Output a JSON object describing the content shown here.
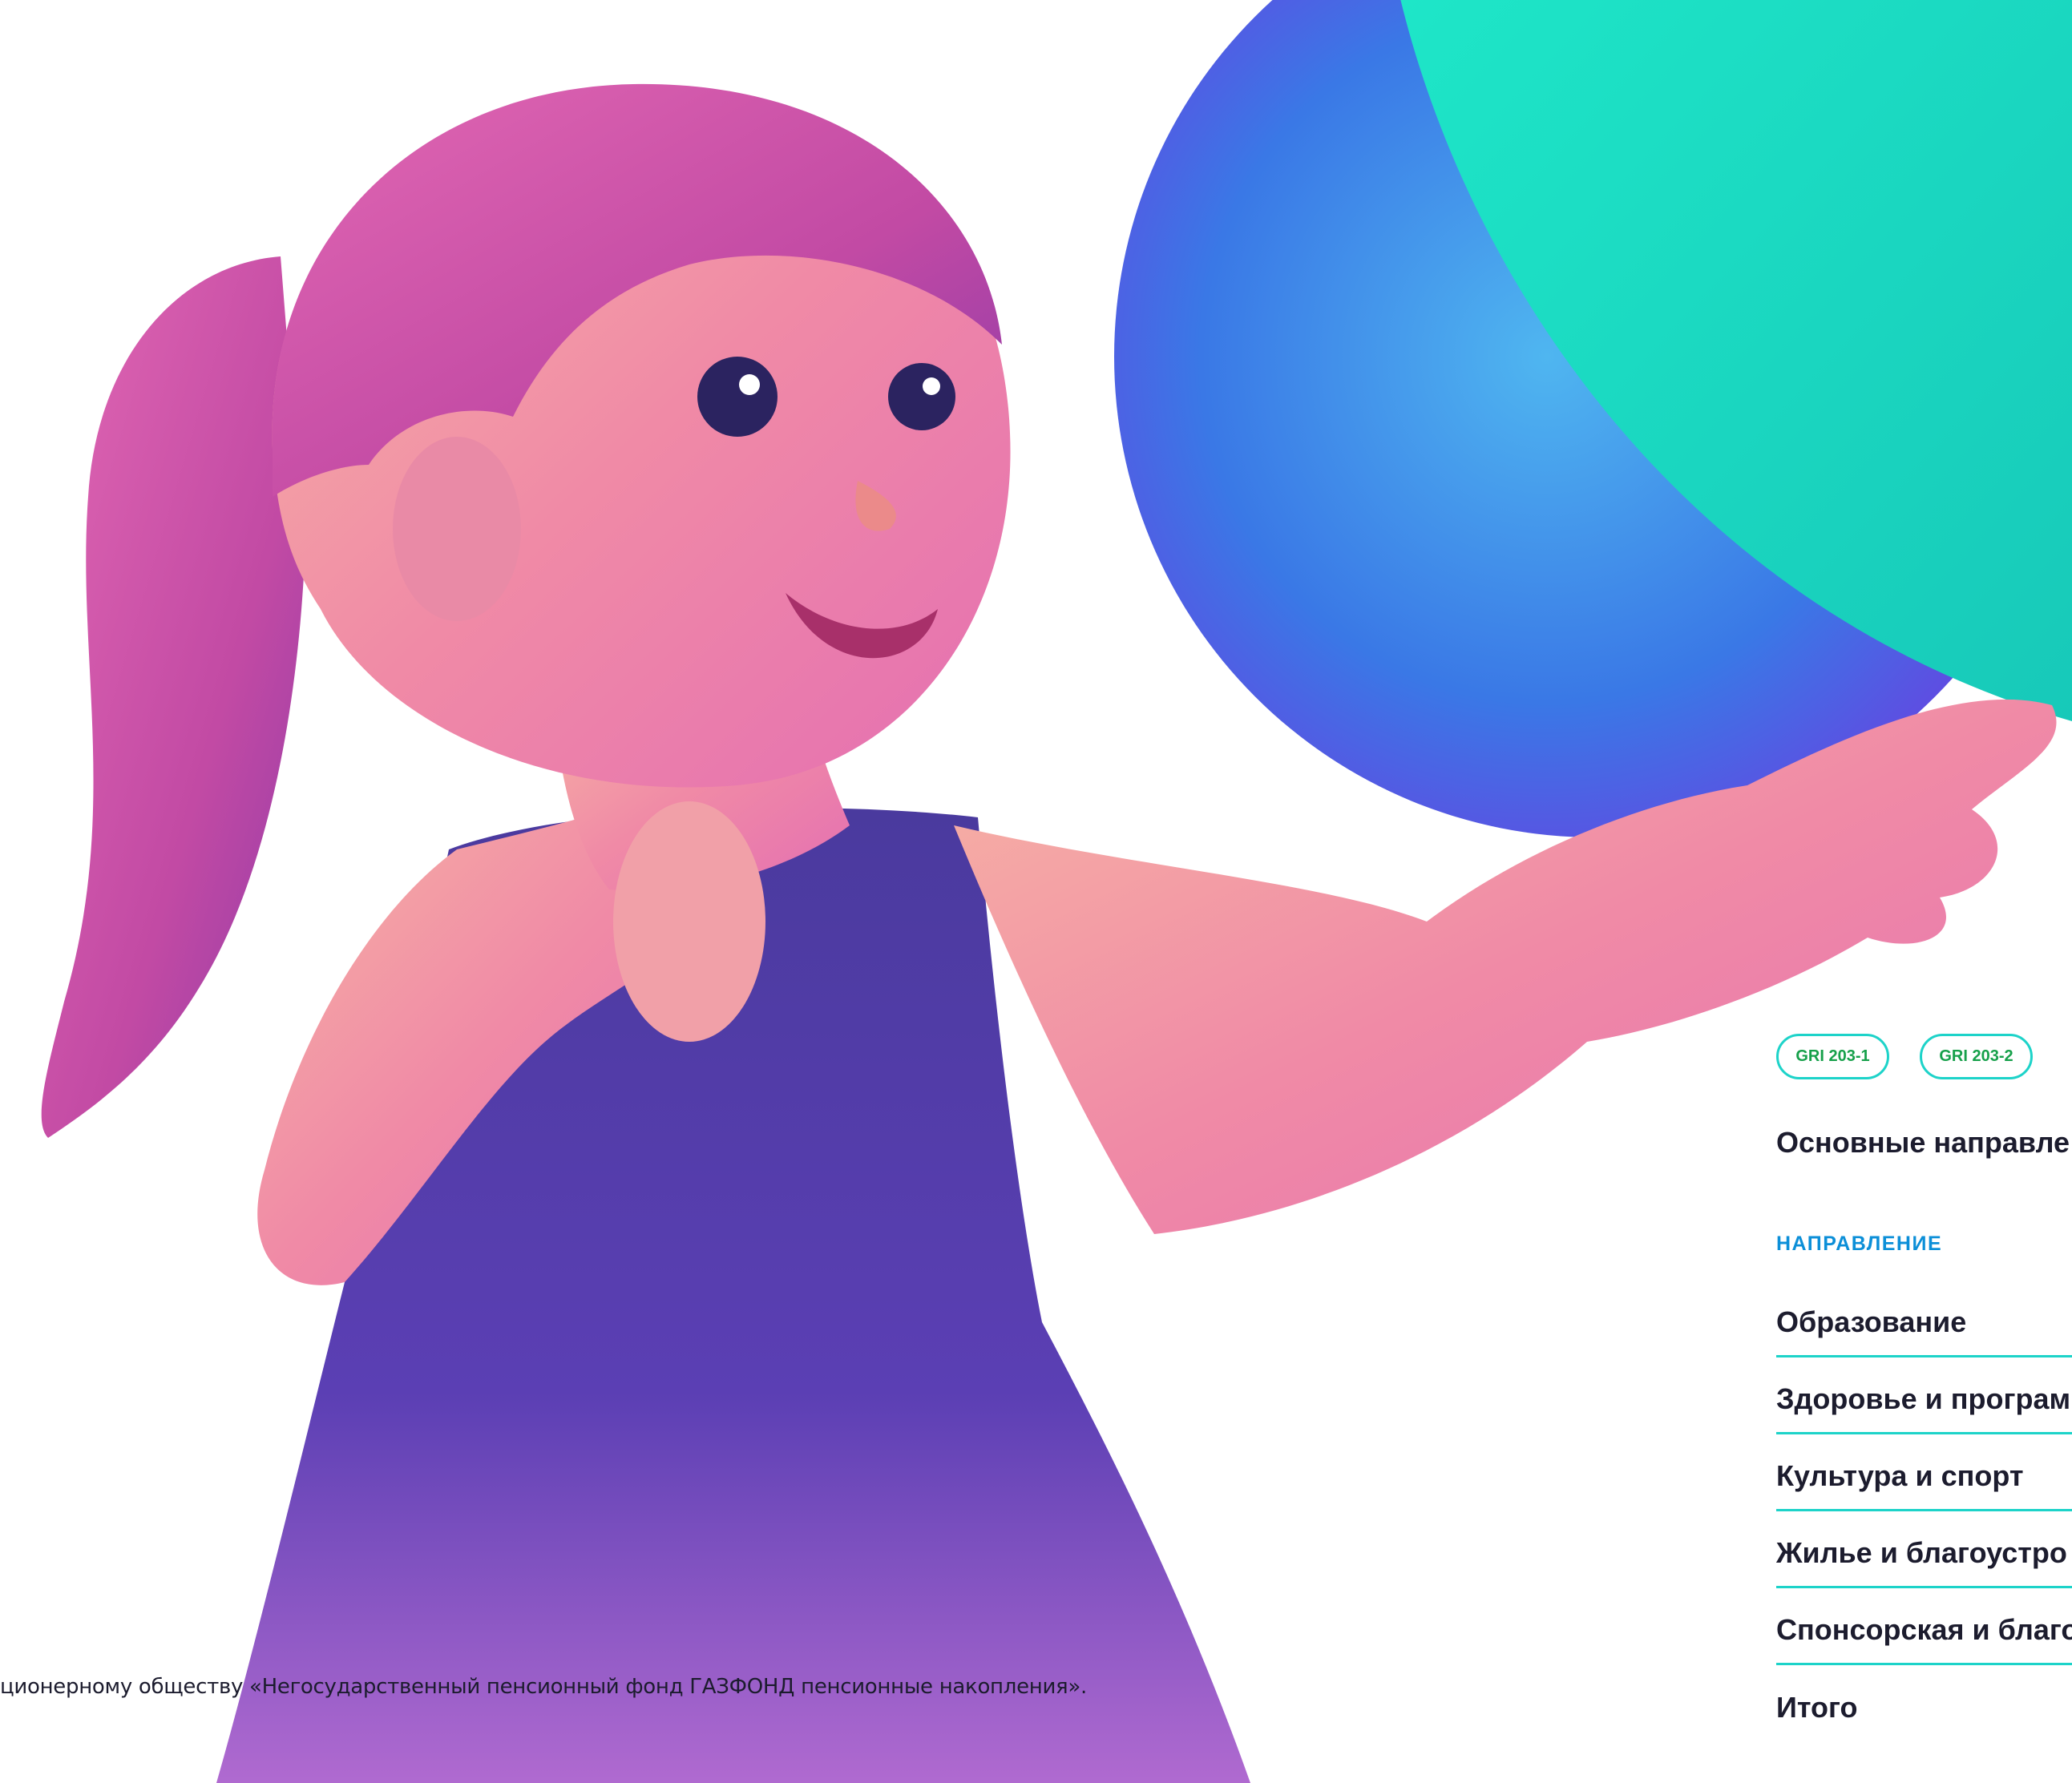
{
  "footnote": "ционерному обществу «Негосударственный пенсионный фонд ГАЗФОНД пенсионные накопления».",
  "badges": [
    "GRI 203-1",
    "GRI 203-2"
  ],
  "heading": "Основные направле",
  "column_label": "НАПРАВЛЕНИЕ",
  "rows": [
    "Образование",
    "Здоровье и програм",
    "Культура и спорт",
    "Жилье и благоустро",
    "Спонсорская и благо",
    "Итого"
  ],
  "colors": {
    "accent_teal": "#1dd3c9",
    "badge_text": "#16a04a",
    "label_blue": "#0c8fd8",
    "text": "#1c1c2e"
  }
}
